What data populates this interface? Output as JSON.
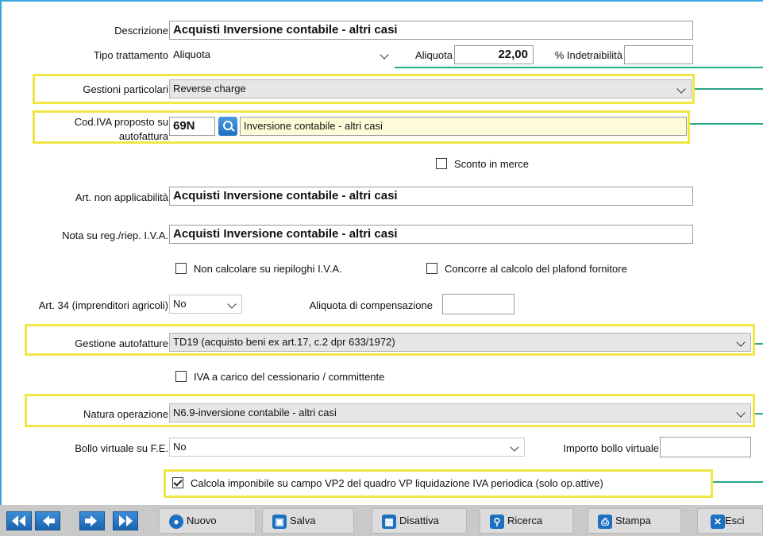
{
  "form": {
    "descrizione": {
      "label": "Descrizione",
      "value": "Acquisti Inversione contabile - altri casi"
    },
    "tipo_trattamento": {
      "label": "Tipo trattamento",
      "value": "Aliquota"
    },
    "aliquota": {
      "label": "Aliquota",
      "value": "22,00"
    },
    "indetraibilita": {
      "label": "% Indetraibilità",
      "value": ""
    },
    "gestioni_particolari": {
      "label": "Gestioni particolari",
      "value": "Reverse charge"
    },
    "cod_iva": {
      "label_line1": "Cod.IVA proposto su",
      "label_line2": "autofattura",
      "code": "69N",
      "description": "Inversione contabile - altri casi"
    },
    "sconto_merce": {
      "label": "Sconto in merce",
      "checked": false
    },
    "art_non_applicabilita": {
      "label": "Art. non applicabilità",
      "value": "Acquisti Inversione contabile - altri casi"
    },
    "nota_reg": {
      "label": "Nota su reg./riep. I.V.A.",
      "value": "Acquisti Inversione contabile - altri casi"
    },
    "non_calcolare": {
      "label": "Non calcolare su riepiloghi I.V.A.",
      "checked": false
    },
    "concorre_plafond": {
      "label": "Concorre al calcolo del plafond fornitore",
      "checked": false
    },
    "art34": {
      "label": "Art. 34 (imprenditori agricoli)",
      "value": "No"
    },
    "aliquota_compensazione": {
      "label": "Aliquota di compensazione",
      "value": ""
    },
    "gestione_autofatture": {
      "label": "Gestione autofatture",
      "value": "TD19 (acquisto beni ex art.17, c.2 dpr 633/1972)"
    },
    "iva_carico": {
      "label": "IVA a carico del cessionario / committente",
      "checked": false
    },
    "natura_operazione": {
      "label": "Natura operazione",
      "value": "N6.9-inversione contabile - altri casi"
    },
    "bollo_virtuale": {
      "label": "Bollo virtuale su F.E.",
      "value": "No"
    },
    "importo_bollo": {
      "label": "Importo bollo virtuale",
      "value": ""
    },
    "calcola_imponibile": {
      "label": "Calcola imponibile su campo VP2 del quadro VP liquidazione IVA periodica (solo op.attive)",
      "checked": true
    }
  },
  "toolbar": {
    "nuovo": "Nuovo",
    "salva": "Salva",
    "disattiva": "Disattiva",
    "ricerca": "Ricerca",
    "stampa": "Stampa",
    "esci": "Esci"
  },
  "colors": {
    "highlight": "#f0e645",
    "accent": "#3aa6df",
    "callout": "#2aa88a",
    "icon": "#1d6fc0"
  }
}
